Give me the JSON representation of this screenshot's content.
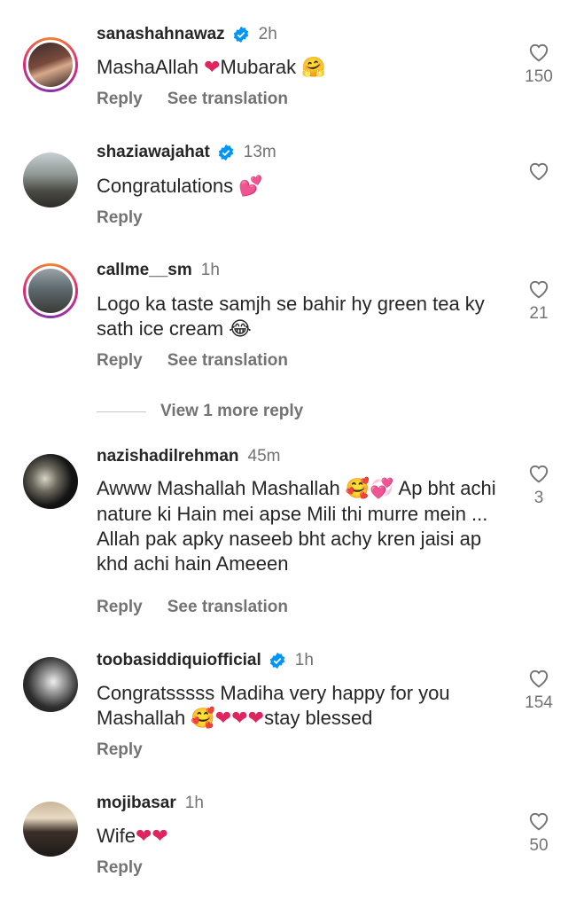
{
  "comments": [
    {
      "username": "sanashahnawaz",
      "verified": true,
      "time": "2h",
      "text_parts": [
        "MashaAllah ",
        "❤",
        "Mubarak ",
        "🤗"
      ],
      "reply_label": "Reply",
      "translate_label": "See translation",
      "likes": "150"
    },
    {
      "username": "shaziawajahat",
      "verified": true,
      "time": "13m",
      "text_parts": [
        "Congratulations ",
        "💕"
      ],
      "reply_label": "Reply",
      "likes": ""
    },
    {
      "username": "callme__sm",
      "verified": false,
      "time": "1h",
      "text_parts": [
        "Logo ka taste samjh se bahir hy green tea ky sath ice cream ",
        "😂"
      ],
      "reply_label": "Reply",
      "translate_label": "See translation",
      "likes": "21",
      "view_more": "View 1 more reply"
    },
    {
      "username": "nazishadilrehman",
      "verified": false,
      "time": "45m",
      "text_parts": [
        "Awww Mashallah Mashallah ",
        "🥰💞",
        " Ap bht achi nature ki Hain mei apse Mili thi murre mein ... Allah pak apky naseeb bht achy kren jaisi ap khd achi hain Ameeen"
      ],
      "reply_label": "Reply",
      "translate_label": "See translation",
      "likes": "3"
    },
    {
      "username": "toobasiddiquiofficial",
      "verified": true,
      "time": "1h",
      "text_parts": [
        "Congratsssss Madiha very happy for you Mashallah ",
        "🥰❤❤❤",
        "stay blessed"
      ],
      "reply_label": "Reply",
      "likes": "154"
    },
    {
      "username": "mojibasar",
      "verified": false,
      "time": "1h",
      "text_parts": [
        "Wife",
        "❤❤"
      ],
      "reply_label": "Reply",
      "likes": "50"
    }
  ],
  "colors": {
    "verified_blue": "#0095f6",
    "heart_red": "#e0245e",
    "muted": "#737373"
  },
  "icons": {
    "like": "heart-outline-icon",
    "verified": "verified-badge-icon"
  }
}
